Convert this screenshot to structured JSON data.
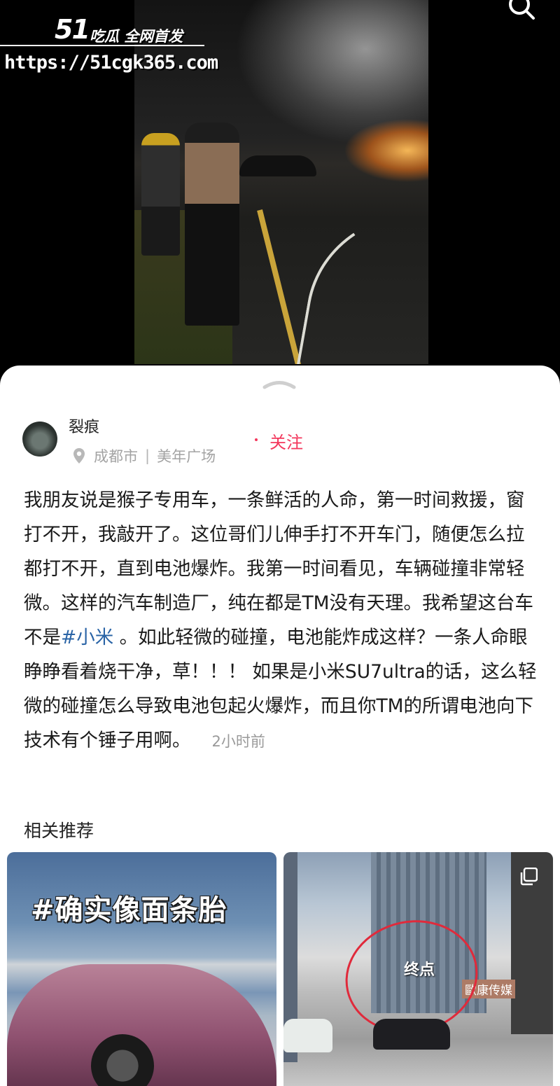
{
  "watermark": {
    "logo": "51",
    "tagline": "吃瓜 全网首发",
    "url": "https://51cgk365.com"
  },
  "icons": {
    "search": "search-icon",
    "handle": "chevron-up-icon",
    "location": "location-pin-icon",
    "multi_image": "multi-image-icon"
  },
  "author": {
    "name": "裂痕",
    "city": "成都市",
    "separator": "|",
    "place": "美年广场"
  },
  "follow_label": "关注",
  "post": {
    "text_before_tag": "我朋友说是猴子专用车，一条鲜活的人命，第一时间救援，窗打不开，我敲开了。这位哥们儿伸手打不开车门，随便怎么拉都打不开，直到电池爆炸。我第一时间看见，车辆碰撞非常轻微。这样的汽车制造厂，纯在都是TM没有天理。我希望这台车不是",
    "hashtag": "#小米",
    "text_after_tag": " 。如此轻微的碰撞，电池能炸成这样？一条人命眼睁睁看着烧干净，草！！！ 如果是小米SU7ultra的话，这么轻微的碰撞怎么导致电池包起火爆炸，而且你TM的所谓电池向下技术有个锤子用啊。",
    "time": "2小时前"
  },
  "recommend": {
    "title": "相关推荐",
    "cards": [
      {
        "overlay": "#确实像面条胎"
      },
      {
        "label": "终点",
        "sign": "歐康传媒"
      }
    ]
  },
  "colors": {
    "follow": "#f3375c",
    "hashtag": "#2a64a6",
    "annotation": "#e02a3b"
  }
}
